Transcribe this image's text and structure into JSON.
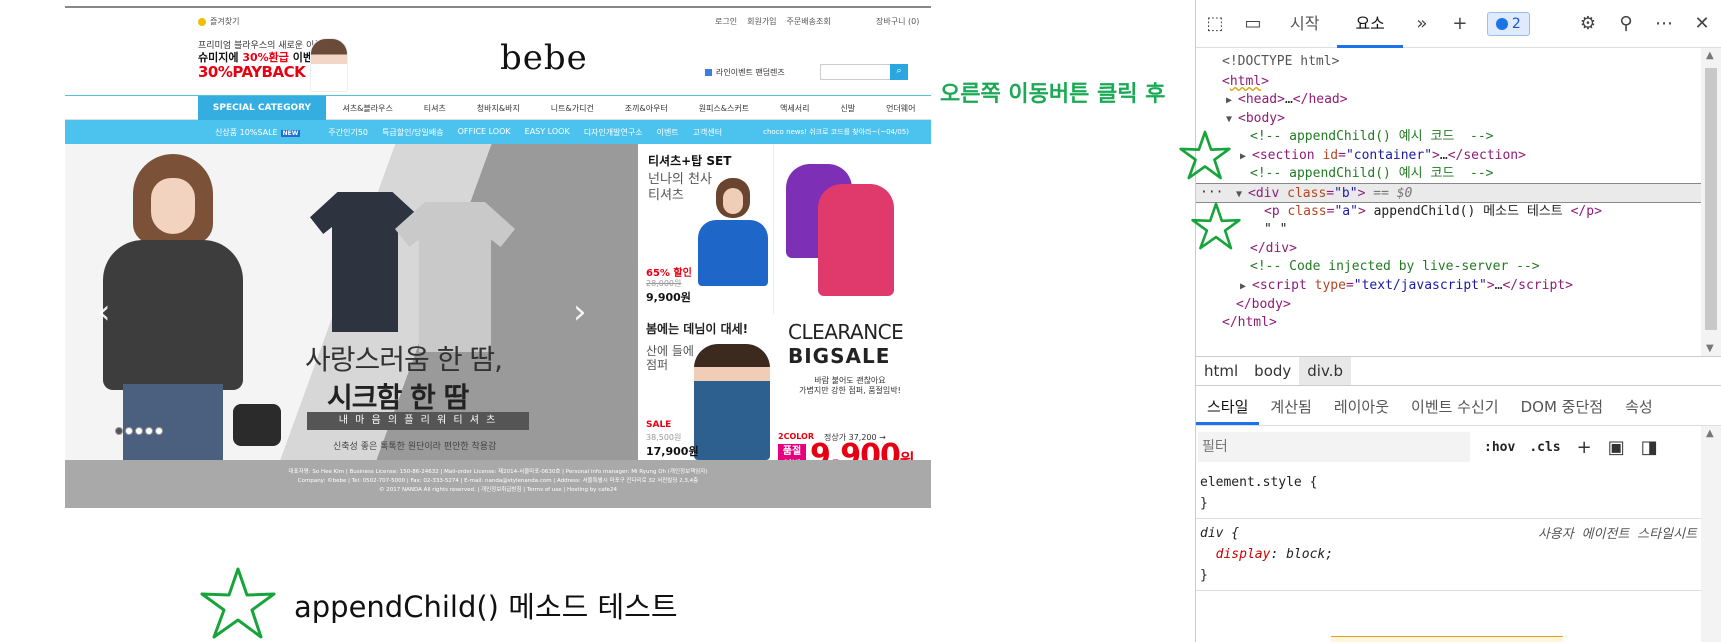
{
  "site": {
    "favorites": "즐겨찾기",
    "top_links": [
      "로그인",
      "회원가입",
      "주문배송조회"
    ],
    "cart": "장바구니 (0)",
    "promo_line1": "프리미엄 블라우스의 새로운 이름",
    "promo_line2a": "슈미지에 ",
    "promo_line2b": "30%환급",
    "promo_line2c": " 이벤트!",
    "promo_line3": "30%PAYBACK",
    "logo": "bebe",
    "live_label": "라인이벤트 팬덤렌즈",
    "search_placeholder": "",
    "special_category": "SPECIAL CATEGORY",
    "categories": [
      "셔츠&블라우스",
      "티셔츠",
      "청바지&바지",
      "니트&가디건",
      "조끼&아우터",
      "원피스&스커트",
      "액세서리",
      "신발",
      "언더웨어"
    ],
    "bluebar_sale": "신상품 10%SALE",
    "bluebar_new": "NEW",
    "bluebar_items": [
      "주간인기50",
      "특급할인/당일배송",
      "OFFICE LOOK",
      "EASY LOOK",
      "디자인개발연구소",
      "이벤트",
      "고객센터"
    ],
    "bluebar_news": "choco news! 쉬크로 코드를 찾아라~(~04/05)",
    "hero": {
      "title1": "사랑스러움 한 땀,",
      "title2": "시크함 한 땀",
      "bar": "내 마 음 의 플 리 워  티 셔 츠",
      "desc": "신축성 좋은 톡톡한 원단이라 편안한 착용감",
      "prev": "‹",
      "next": "›"
    },
    "side1": {
      "title": "티셔츠+탑 SET",
      "sub1": "넌나의 천사",
      "sub2": "티셔츠",
      "discount": "65% 할인",
      "old_price": "28,000원",
      "price": "9,900원"
    },
    "side2": {
      "title": "봄에는 데님이 대세!",
      "sub1": "산에 들에",
      "sub2": "점퍼",
      "sale": "SALE",
      "old_price": "38,500원",
      "price": "17,900원"
    },
    "side3": {
      "clearance": "CLEARANCE",
      "bigsale": "BIGSALE",
      "desc1": "바람 불어도 괜찮아요",
      "desc2": "가볍지만 강한 점퍼, 품절임박!",
      "color": "2COLOR",
      "regular": "정상가 37,200 →",
      "badge": "품절\n임박",
      "price": "9,900",
      "won": "원"
    },
    "footer_line1": "대표자명: So Hee Kim | Business License: 150-86-24632 | Mail-order License: 제2014-서울마포-0630호 | Personal info manager: Mi Ryung Oh (개인정보책임자)",
    "footer_line2": "Company: ©bebe | Tel: 0502-707-5000 | Fax: 02-333-5274 | E-mail: nanda@stylenanda.com | Address: 서울특별시 마포구 잔다리로 32 서진빌딩 2,3,4층",
    "footer_line3": "© 2017 NANDA All rights reserved. | 개인정보취급방침 | Terms of use | Hosting by cafe24"
  },
  "annotations": {
    "left_text": "appendChild() 메소드 테스트",
    "right_text": "오른쪽 이동버튼 클릭 후",
    "star_color": "#17a43b"
  },
  "devtools": {
    "tabs": [
      "시작",
      "요소"
    ],
    "active_tab": "요소",
    "badge_count": "2",
    "dom_lines": {
      "doctype": "<!DOCTYPE html>",
      "html_open": "html",
      "head": "head",
      "body_open": "body",
      "comment1": "<!-- appendChild() 예시 코드  -->",
      "section_attr": "id",
      "section_val": "\"container\"",
      "comment2": "<!-- appendChild() 예시 코드  -->",
      "div_attr": "class",
      "div_val": "\"b\"",
      "eq0": "== $0",
      "p_attr": "class",
      "p_val": "\"a\"",
      "p_text": " appendChild() 메소드 테스트 ",
      "text_node": "\" \"",
      "comment3": "<!-- Code injected by live-server -->",
      "script_attr": "type",
      "script_val": "\"text/javascript\""
    },
    "breadcrumb": [
      "html",
      "body",
      "div.b"
    ],
    "subtabs": [
      "스타일",
      "계산됨",
      "레이아웃",
      "이벤트 수신기",
      "DOM 중단점",
      "속성"
    ],
    "filter_placeholder": "필터",
    "hov": ":hov",
    "cls": ".cls",
    "styles": {
      "element_style": "element.style {",
      "close": "}",
      "div_selector": "div {",
      "user_agent": "사용자 에이전트 스타일시트",
      "prop_name": "display",
      "prop_value": "block"
    }
  }
}
